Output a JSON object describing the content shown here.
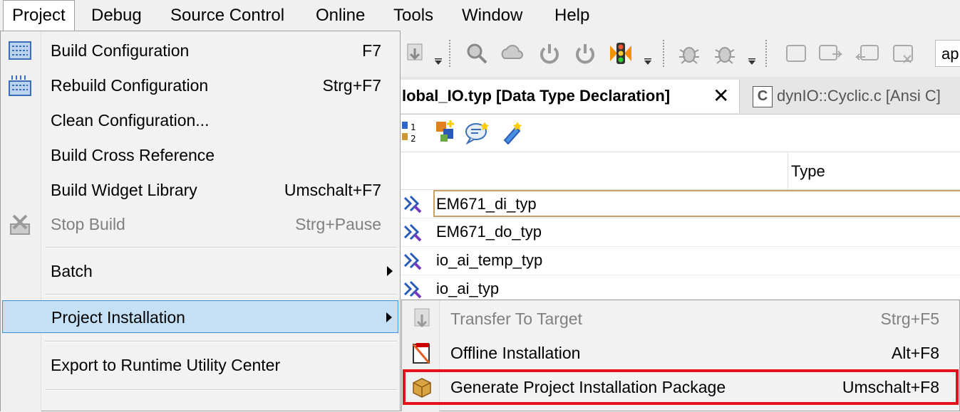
{
  "menubar": {
    "items": [
      "Project",
      "Debug",
      "Source Control",
      "Online",
      "Tools",
      "Window",
      "Help"
    ],
    "active": "Project"
  },
  "toolbar": {
    "combo_text": "ap",
    "icons": [
      "download-icon",
      "search-icon",
      "cloud-icon",
      "power-icon",
      "power-off-icon",
      "traffic-light-icon",
      "bug-icon",
      "bug-step-icon",
      "window-icon",
      "window-arrow-icon",
      "window-back-icon",
      "window-disabled-icon"
    ]
  },
  "tabs": [
    {
      "label": "lobal_IO.typ [Data Type Declaration]",
      "close": "✕",
      "active": true
    },
    {
      "icon_label": "C",
      "label": "dynIO::Cyclic.c [Ansi C]",
      "active": false
    }
  ],
  "subtoolbar": {
    "icons": [
      "numbering-icon",
      "add-item-icon",
      "comment-icon",
      "link-icon"
    ]
  },
  "table": {
    "columns": {
      "type": "Type"
    },
    "rows": [
      {
        "name": "EM671_di_typ",
        "selected": true
      },
      {
        "name": "EM671_do_typ",
        "selected": false
      },
      {
        "name": "io_ai_temp_typ",
        "selected": false
      },
      {
        "name": "io_ai_typ",
        "selected": false
      }
    ]
  },
  "project_menu": {
    "items": [
      {
        "label": "Build Configuration",
        "shortcut": "F7",
        "icon": "build-icon"
      },
      {
        "label": "Rebuild Configuration",
        "shortcut": "Strg+F7",
        "icon": "rebuild-icon"
      },
      {
        "label": "Clean Configuration...",
        "shortcut": ""
      },
      {
        "label": "Build Cross Reference",
        "shortcut": ""
      },
      {
        "label": "Build Widget Library",
        "shortcut": "Umschalt+F7"
      },
      {
        "label": "Stop Build",
        "shortcut": "Strg+Pause",
        "icon": "stop-build-icon",
        "disabled": true
      },
      {
        "label": "Batch",
        "submenu": true
      },
      {
        "label": "Project Installation",
        "submenu": true,
        "highlighted": true
      },
      {
        "label": "Export to Runtime Utility Center",
        "shortcut": ""
      }
    ]
  },
  "installation_submenu": {
    "items": [
      {
        "label": "Transfer To Target",
        "shortcut": "Strg+F5",
        "icon": "transfer-icon",
        "disabled": true
      },
      {
        "label": "Offline Installation",
        "shortcut": "Alt+F8",
        "icon": "offline-install-icon"
      },
      {
        "label": "Generate Project Installation Package",
        "shortcut": "Umschalt+F8",
        "icon": "package-icon",
        "boxed": true
      }
    ]
  },
  "colors": {
    "highlight_bg": "#c5e0f5",
    "highlight_border": "#3c8fd8",
    "annotation_red": "#e8101a"
  }
}
